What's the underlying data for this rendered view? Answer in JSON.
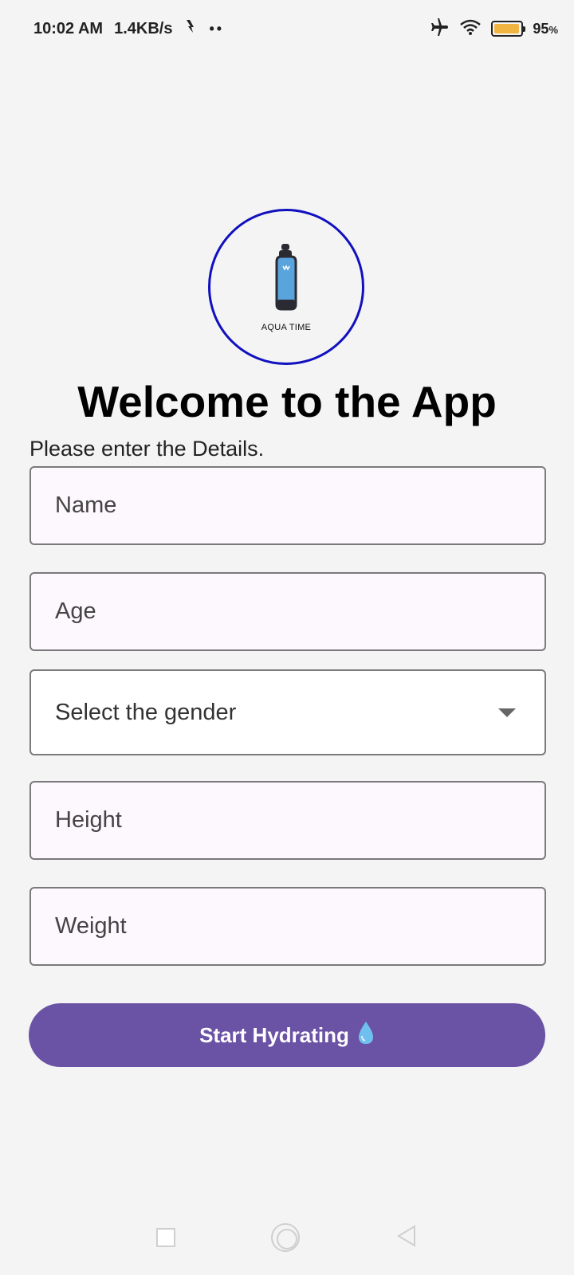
{
  "status_bar": {
    "time": "10:02 AM",
    "net_speed": "1.4KB/s",
    "dots": "••",
    "battery_percent": "95",
    "battery_unit": "%",
    "battery_level": 0.95,
    "battery_color": "#f2b440"
  },
  "logo": {
    "text": "AQUA TIME",
    "icon": "water-bottle-icon",
    "ring_color": "#1010c0"
  },
  "welcome": {
    "title": "Welcome to the App",
    "subtitle": "Please enter the Details."
  },
  "form": {
    "name_placeholder": "Name",
    "age_placeholder": "Age",
    "gender_label": "Select the gender",
    "height_placeholder": "Height",
    "weight_placeholder": "Weight"
  },
  "button": {
    "label": "Start Hydrating",
    "icon": "water-drop-icon",
    "color": "#6a52a4"
  },
  "nav": {
    "recents": "square-icon",
    "home": "circle-icon",
    "back": "triangle-back-icon"
  }
}
